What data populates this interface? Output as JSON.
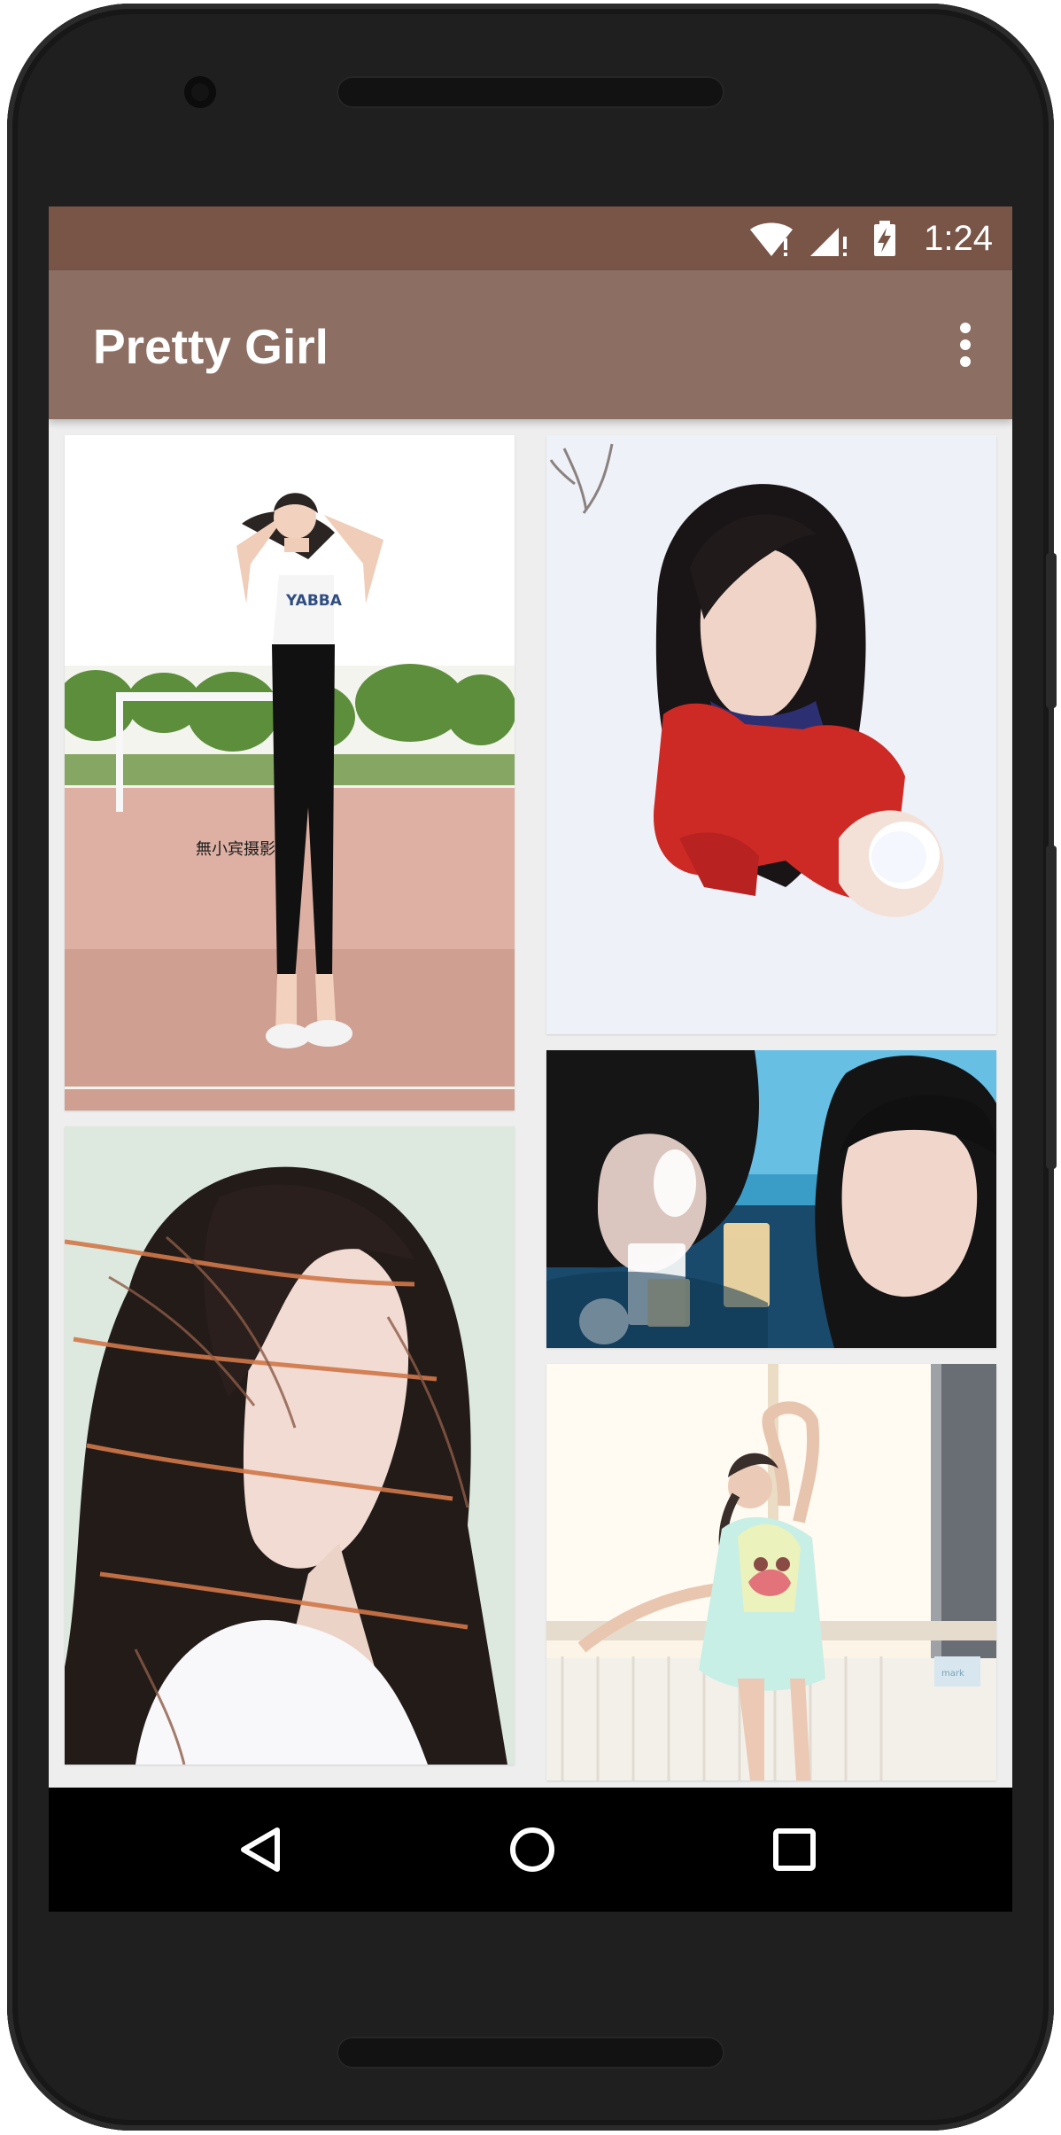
{
  "status_bar": {
    "time": "1:24",
    "icons": [
      "wifi-icon",
      "cell-signal-icon",
      "battery-charging-icon"
    ],
    "background_color": "#795548"
  },
  "app_bar": {
    "title": "Pretty Girl",
    "menu_icon": "more-vert-icon",
    "background_color": "#8d6e63"
  },
  "gallery": {
    "background_color": "#eeeeee",
    "photos": [
      {
        "name": "photo-girl-field",
        "watermark": "無小宾摄影"
      },
      {
        "name": "photo-girl-snow"
      },
      {
        "name": "photo-girl-windy-hair"
      },
      {
        "name": "photo-girl-reflection"
      },
      {
        "name": "photo-girl-window"
      }
    ]
  },
  "navigation_bar": {
    "buttons": [
      "back-icon",
      "home-icon",
      "recents-icon"
    ]
  }
}
